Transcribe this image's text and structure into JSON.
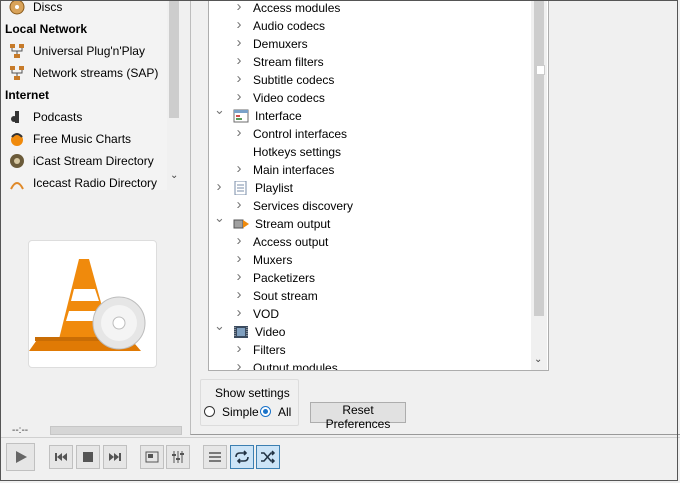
{
  "sidebar": {
    "items_top": [
      {
        "label": "Discs",
        "icon": "disc-icon"
      }
    ],
    "sections": [
      {
        "heading": "Local Network",
        "items": [
          {
            "label": "Universal Plug'n'Play",
            "icon": "network-icon"
          },
          {
            "label": "Network streams (SAP)",
            "icon": "network-icon"
          }
        ]
      },
      {
        "heading": "Internet",
        "items": [
          {
            "label": "Podcasts",
            "icon": "podcast-icon"
          },
          {
            "label": "Free Music Charts",
            "icon": "music-charts-icon"
          },
          {
            "label": "iCast Stream Directory",
            "icon": "icast-icon"
          },
          {
            "label": "Icecast Radio Directory",
            "icon": "icecast-icon"
          }
        ]
      }
    ]
  },
  "tree": {
    "rows": [
      {
        "label": "Access modules",
        "level": 1,
        "expander": ">"
      },
      {
        "label": "Audio codecs",
        "level": 1,
        "expander": ">"
      },
      {
        "label": "Demuxers",
        "level": 1,
        "expander": ">"
      },
      {
        "label": "Stream filters",
        "level": 1,
        "expander": ">"
      },
      {
        "label": "Subtitle codecs",
        "level": 1,
        "expander": ">"
      },
      {
        "label": "Video codecs",
        "level": 1,
        "expander": ">"
      },
      {
        "label": "Interface",
        "level": 0,
        "expander": "v",
        "icon": "interface-icon"
      },
      {
        "label": "Control interfaces",
        "level": 1,
        "expander": ">"
      },
      {
        "label": "Hotkeys settings",
        "level": 1,
        "expander": ""
      },
      {
        "label": "Main interfaces",
        "level": 1,
        "expander": ">"
      },
      {
        "label": "Playlist",
        "level": 0,
        "expander": ">",
        "icon": "playlist-icon"
      },
      {
        "label": "Services discovery",
        "level": 1,
        "expander": ">"
      },
      {
        "label": "Stream output",
        "level": 0,
        "expander": "v",
        "icon": "stream-output-icon"
      },
      {
        "label": "Access output",
        "level": 1,
        "expander": ">"
      },
      {
        "label": "Muxers",
        "level": 1,
        "expander": ">"
      },
      {
        "label": "Packetizers",
        "level": 1,
        "expander": ">"
      },
      {
        "label": "Sout stream",
        "level": 1,
        "expander": ">"
      },
      {
        "label": "VOD",
        "level": 1,
        "expander": ">"
      },
      {
        "label": "Video",
        "level": 0,
        "expander": "v",
        "icon": "video-icon"
      },
      {
        "label": "Filters",
        "level": 1,
        "expander": ">"
      },
      {
        "label": "Output modules",
        "level": 1,
        "expander": ">"
      }
    ]
  },
  "show_settings": {
    "title": "Show settings",
    "simple_label": "Simple",
    "all_label": "All",
    "selected": "All"
  },
  "reset_button": "Reset Preferences",
  "player": {
    "time": "--:--"
  },
  "controls": [
    {
      "name": "previous-icon"
    },
    {
      "name": "stop-icon"
    },
    {
      "name": "next-icon"
    },
    {
      "name": "fullscreen-icon"
    },
    {
      "name": "extended-settings-icon"
    },
    {
      "name": "playlist-icon"
    },
    {
      "name": "loop-icon"
    },
    {
      "name": "shuffle-icon"
    }
  ],
  "colors": {
    "vlc_orange": "#f08a0c",
    "accent_blue": "#1a73c9"
  }
}
